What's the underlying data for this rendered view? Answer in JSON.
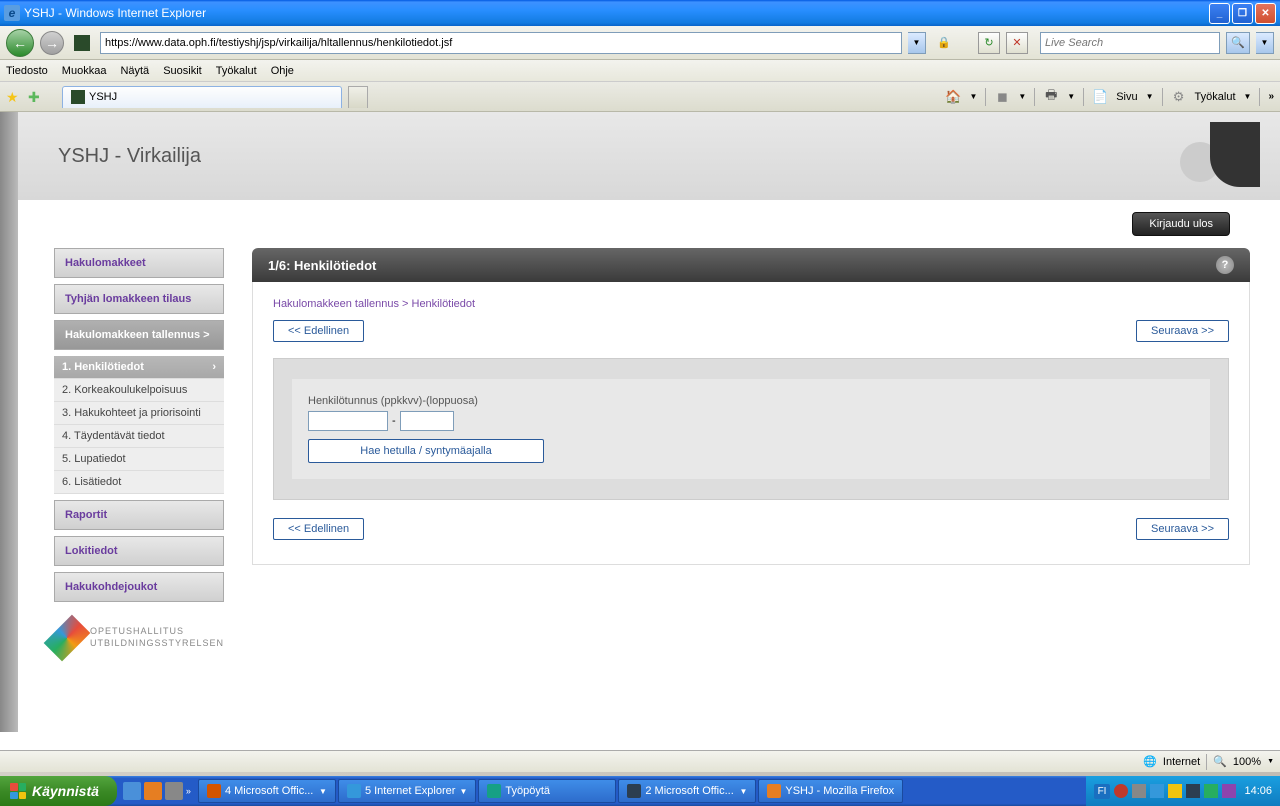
{
  "titlebar": {
    "text": "YSHJ - Windows Internet Explorer"
  },
  "navbar": {
    "url": "https://www.data.oph.fi/testiyshj/jsp/virkailija/hltallennus/henkilotiedot.jsf",
    "search_placeholder": "Live Search"
  },
  "menubar": [
    "Tiedosto",
    "Muokkaa",
    "Näytä",
    "Suosikit",
    "Työkalut",
    "Ohje"
  ],
  "tab": {
    "title": "YSHJ"
  },
  "tabbar_right": {
    "sivu": "Sivu",
    "tyokalut": "Työkalut"
  },
  "page": {
    "header_title": "YSHJ - Virkailija",
    "logout": "Kirjaudu ulos",
    "sidebar": {
      "btn_hakulomakkeet": "Hakulomakkeet",
      "btn_tyhjan": "Tyhjän lomakkeen tilaus",
      "btn_tallennus": "Hakulomakkeen tallennus >",
      "steps": [
        "1. Henkilötiedot",
        "2. Korkeakoulukelpoisuus",
        "3. Hakukohteet ja priorisointi",
        "4. Täydentävät tiedot",
        "5. Lupatiedot",
        "6. Lisätiedot"
      ],
      "btn_raportit": "Raportit",
      "btn_lokitiedot": "Lokitiedot",
      "btn_hakukohdejoukot": "Hakukohdejoukot",
      "logo_line1": "OPETUSHALLITUS",
      "logo_line2": "UTBILDNINGSSTYRELSEN"
    },
    "panel": {
      "title": "1/6: Henkilötiedot",
      "breadcrumb": "Hakulomakkeen tallennus > Henkilötiedot",
      "prev": "<< Edellinen",
      "next": "Seuraava >>",
      "form_label": "Henkilötunnus (ppkkvv)-(loppuosa)",
      "ssn_sep": "-",
      "search_btn": "Hae hetulla / syntymäajalla"
    }
  },
  "statusbar": {
    "internet": "Internet",
    "zoom": "100%"
  },
  "taskbar": {
    "start": "Käynnistä",
    "tasks": [
      "4 Microsoft Offic...",
      "5 Internet Explorer",
      "Työpöytä",
      "2 Microsoft Offic...",
      "YSHJ - Mozilla Firefox"
    ],
    "lang": "FI",
    "clock": "14:06"
  }
}
